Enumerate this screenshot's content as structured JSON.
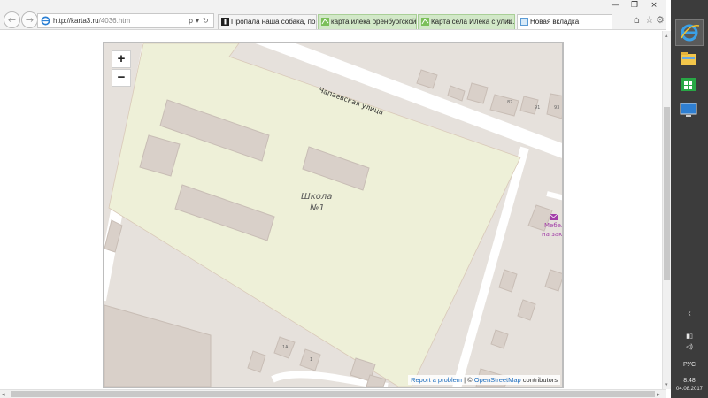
{
  "browser": {
    "nav": {
      "back_glyph": "←",
      "forward_glyph": "→"
    },
    "address": {
      "url_host": "http://karta3.ru",
      "url_path": "/4036.htm",
      "search_glyph": "ρ",
      "dropdown_glyph": "▾",
      "refresh_glyph": "↻",
      "stop_glyph": "×"
    },
    "tabs": [
      {
        "label": "Пропала наша собака, пом...",
        "active": false
      },
      {
        "label": "карта илека оренбургской ...",
        "active": false
      },
      {
        "label": "Карта села Илека с улиц...",
        "active": true
      },
      {
        "label": "Новая вкладка",
        "active": false
      }
    ],
    "tab_close_glyph": "×",
    "window_controls": {
      "minimize": "—",
      "restore": "❐",
      "close": "×"
    },
    "toolbar_icons": [
      "home-icon",
      "star-icon",
      "gear-icon"
    ]
  },
  "map": {
    "zoom_in": "+",
    "zoom_out": "−",
    "street_label": "Чапаевская улица",
    "school_name": "Школа",
    "school_number": "№1",
    "poi_line1": "Мебел",
    "poi_line2": "на зака",
    "house_numbers": [
      "87",
      "91",
      "93",
      "1А",
      "1"
    ],
    "attribution": {
      "report": "Report a problem",
      "separator": " | © ",
      "osm": "OpenStreetMap",
      "contributors": " contributors"
    },
    "colors": {
      "school_area": "#eef0d8",
      "building": "#d9d0c9",
      "road": "#ffffff",
      "background": "#e6e1dc",
      "label": "#555555",
      "poi": "#a23ea8"
    }
  },
  "taskbar": {
    "icons": [
      "internet-explorer-icon",
      "file-explorer-icon",
      "store-icon",
      "desktop-icon"
    ],
    "language": "РУС",
    "time": "8:48",
    "date": "04.08.2017"
  }
}
